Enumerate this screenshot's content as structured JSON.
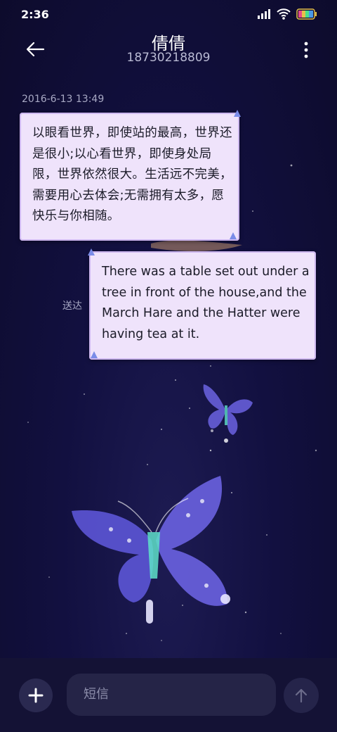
{
  "status_bar": {
    "time": "2:36",
    "icons": [
      "signal-icon",
      "wifi-icon",
      "battery-icon"
    ]
  },
  "header": {
    "contact_name": "倩倩",
    "phone_number": "18730218809",
    "icons": [
      "back-arrow-icon",
      "more-options-icon"
    ]
  },
  "conversation": {
    "timestamp": "2016-6-13 13:49",
    "messages": [
      {
        "direction": "incoming",
        "text": "以眼看世界，即使站的最高，世界还是很小;以心看世界，即使身处局限，世界依然很大。生活远不完美，需要用心去体会;无需拥有太多，愿快乐与你相随。"
      },
      {
        "direction": "outgoing",
        "text": "There was a table set out under a tree in front of the house,and the March Hare and the Hatter were having tea at it.",
        "status": "送达"
      }
    ]
  },
  "composer": {
    "placeholder": "短信",
    "icons": [
      "add-icon",
      "send-arrow-icon"
    ]
  },
  "colors": {
    "background": "#0f0d32",
    "bubble": "#efe3fb",
    "bubble_border": "#cdb7ef",
    "input_bar": "#141235",
    "butterfly": "#6a62e0"
  }
}
